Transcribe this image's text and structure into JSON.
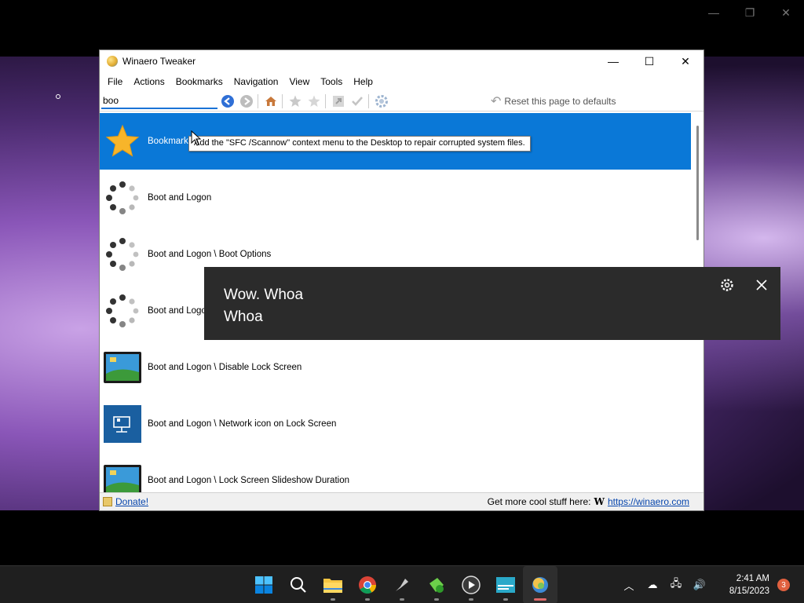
{
  "app": {
    "title": "Winaero Tweaker"
  },
  "menu": [
    "File",
    "Actions",
    "Bookmarks",
    "Navigation",
    "View",
    "Tools",
    "Help"
  ],
  "search": {
    "value": "boo"
  },
  "toolbar": {
    "reset_label": "Reset this page to defaults"
  },
  "list_items": [
    {
      "label": "Bookmarks",
      "icon": "star-icon",
      "selected": true
    },
    {
      "label": "Boot and Logon",
      "icon": "spinner-icon"
    },
    {
      "label": "Boot and Logon \\ Boot Options",
      "icon": "spinner-icon"
    },
    {
      "label": "Boot and Logon \\ ",
      "icon": "spinner-icon"
    },
    {
      "label": "Boot and Logon \\ Disable Lock Screen",
      "icon": "lockscreen-icon"
    },
    {
      "label": "Boot and Logon \\ Network icon on Lock Screen",
      "icon": "network-icon"
    },
    {
      "label": "Boot and Logon \\ Lock Screen Slideshow Duration",
      "icon": "lockscreen-icon"
    }
  ],
  "tooltip": "Add the \"SFC /Scannow\" context menu to the Desktop to repair corrupted system files.",
  "status": {
    "donate": "Donate!",
    "more": "Get more cool stuff here:",
    "link": "https://winaero.com"
  },
  "toast": {
    "line1": "Wow. Whoa",
    "line2": "Whoa"
  },
  "taskbar": {
    "apps": [
      "start-icon",
      "search-icon",
      "file-explorer-icon",
      "chrome-icon",
      "app-icon",
      "app-icon",
      "media-player-icon",
      "app-icon",
      "winaero-tweaker-icon"
    ],
    "time": "2:41 AM",
    "date": "8/15/2023",
    "notifications": "3"
  },
  "colors": {
    "accent": "#0a78d7",
    "toast_bg": "#2b2b2b"
  }
}
